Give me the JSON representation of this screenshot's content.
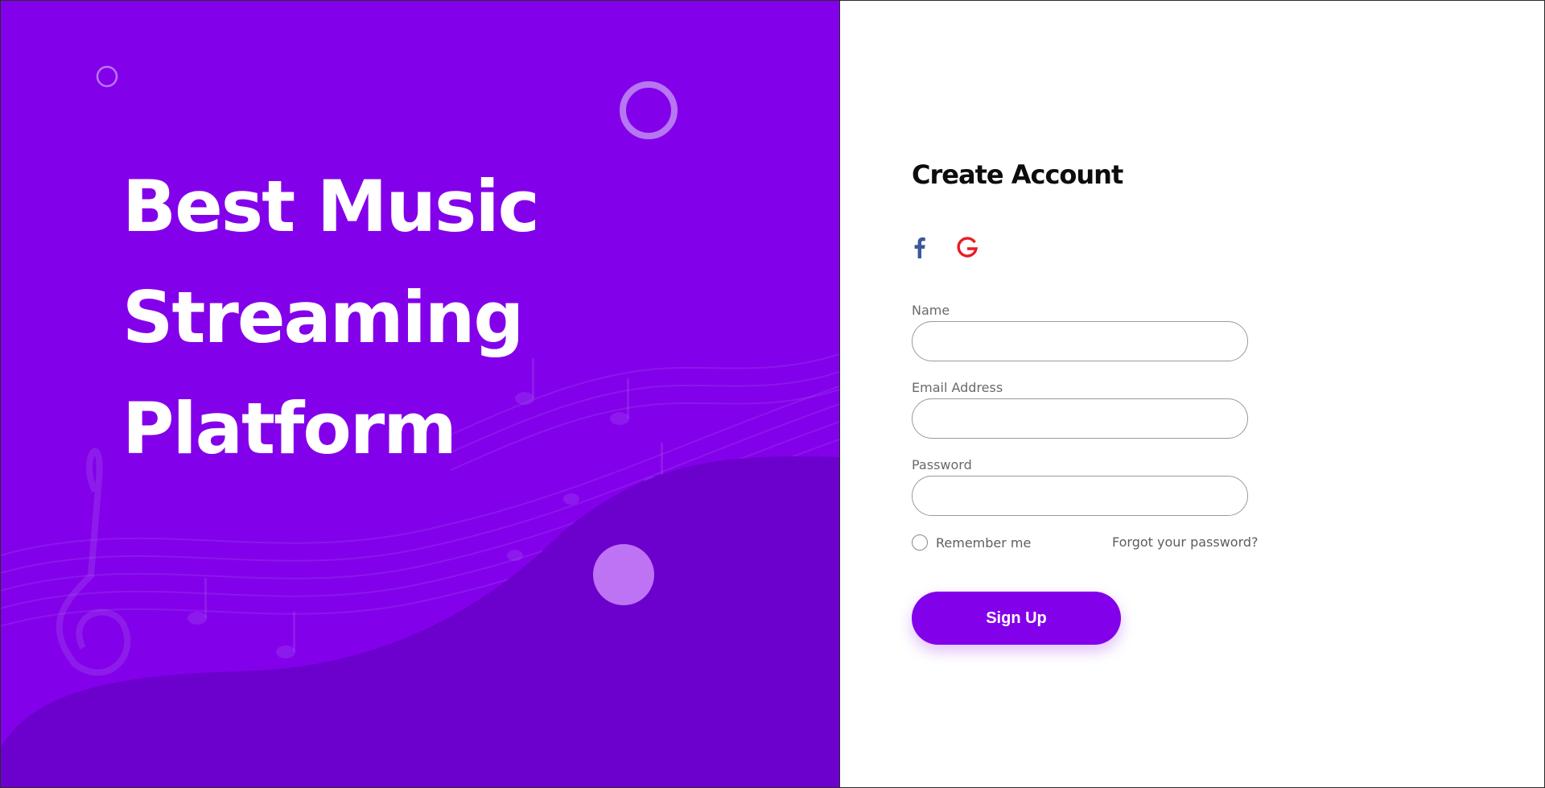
{
  "hero": {
    "title_lines": [
      "Best Music",
      "Streaming",
      "Platform"
    ]
  },
  "form": {
    "title": "Create Account",
    "social": [
      {
        "name": "facebook",
        "icon": "facebook-icon",
        "color": "#3b5998"
      },
      {
        "name": "google",
        "icon": "google-icon",
        "color": "#ea1c24"
      }
    ],
    "fields": {
      "name": {
        "label": "Name",
        "value": ""
      },
      "email": {
        "label": "Email Address",
        "value": ""
      },
      "password": {
        "label": "Password",
        "value": ""
      }
    },
    "remember_label": "Remember me",
    "remember_checked": false,
    "forgot_label": "Forgot your password?",
    "submit_label": "Sign Up"
  },
  "colors": {
    "accent": "#8300ea",
    "accent_dark": "#6c00cc",
    "panel_bg": "#ffffff"
  }
}
